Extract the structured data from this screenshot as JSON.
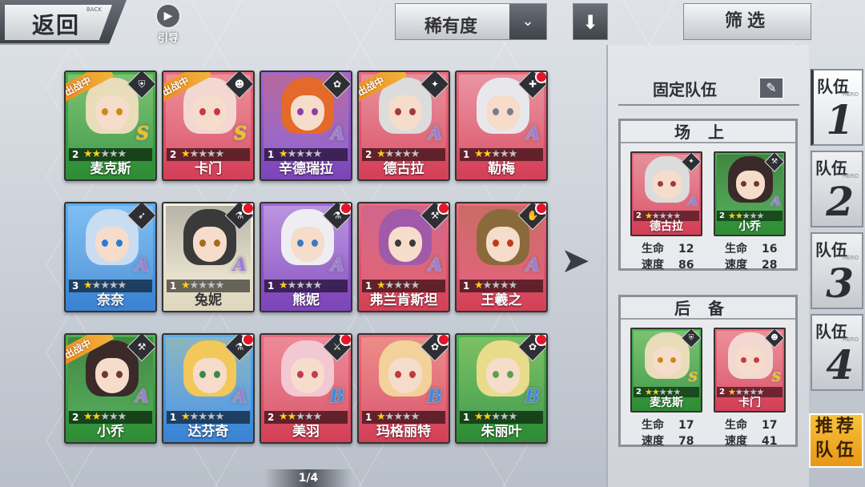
{
  "header": {
    "back_label": "返回",
    "back_sub": "BACK",
    "guide_label": "引导",
    "sort_label": "稀有度",
    "filter_label": "筛选"
  },
  "roster": [
    {
      "name": "麦克斯",
      "level": "2",
      "stars": 2,
      "grade": "S",
      "frame": "green",
      "in_battle": true,
      "badge": false,
      "class_icon": "shield-icon",
      "hair": "#e8ddb8",
      "eye": "#c98a1a"
    },
    {
      "name": "卡门",
      "level": "2",
      "stars": 1,
      "grade": "S",
      "frame": "red",
      "in_battle": true,
      "badge": false,
      "class_icon": "mask-icon",
      "hair": "#f3d8d2",
      "eye": "#c23a4a"
    },
    {
      "name": "辛德瑞拉",
      "level": "1",
      "stars": 1,
      "grade": "A",
      "frame": "purple",
      "in_battle": false,
      "badge": false,
      "class_icon": "rose-icon",
      "hair": "#e36a2a",
      "eye": "#8b3fa6"
    },
    {
      "name": "德古拉",
      "level": "2",
      "stars": 1,
      "grade": "A",
      "frame": "red",
      "in_battle": true,
      "badge": false,
      "class_icon": "shuriken-icon",
      "hair": "#dcdcdc",
      "eye": "#a23a3a"
    },
    {
      "name": "勒梅",
      "level": "1",
      "stars": 2,
      "grade": "A",
      "frame": "red",
      "in_battle": false,
      "badge": true,
      "class_icon": "cross-icon",
      "hair": "#e8e8ec",
      "eye": "#7a7a90"
    },
    {
      "name": "奈奈",
      "level": "3",
      "stars": 1,
      "grade": "A",
      "frame": "blue",
      "in_battle": false,
      "badge": false,
      "class_icon": "wing-icon",
      "hair": "#c8ddf2",
      "eye": "#2a7ad2"
    },
    {
      "name": "兔妮",
      "level": "1",
      "stars": 1,
      "grade": "A",
      "frame": "white",
      "in_battle": false,
      "badge": true,
      "class_icon": "flask-icon",
      "hair": "#3a3a3a",
      "eye": "#a86a1a"
    },
    {
      "name": "熊妮",
      "level": "1",
      "stars": 1,
      "grade": "A",
      "frame": "purple",
      "in_battle": false,
      "badge": true,
      "class_icon": "flask-icon",
      "hair": "#eeeef2",
      "eye": "#3a7ac2"
    },
    {
      "name": "弗兰肯斯坦",
      "level": "1",
      "stars": 1,
      "grade": "A",
      "frame": "red",
      "in_battle": false,
      "badge": true,
      "class_icon": "hammer-icon",
      "hair": "#a05aa8",
      "eye": "#3a3a3a"
    },
    {
      "name": "王羲之",
      "level": "1",
      "stars": 1,
      "grade": "A",
      "frame": "red",
      "in_battle": false,
      "badge": true,
      "class_icon": "hand-icon",
      "hair": "#8a6a3a",
      "eye": "#c23a1a"
    },
    {
      "name": "小乔",
      "level": "2",
      "stars": 2,
      "grade": "A",
      "frame": "green",
      "in_battle": true,
      "badge": false,
      "class_icon": "hammer-icon",
      "hair": "#3a2a2a",
      "eye": "#6a3a2a"
    },
    {
      "name": "达芬奇",
      "level": "1",
      "stars": 1,
      "grade": "A",
      "frame": "blue",
      "in_battle": false,
      "badge": true,
      "class_icon": "flask-icon",
      "hair": "#f2c85a",
      "eye": "#3a8a4a"
    },
    {
      "name": "美羽",
      "level": "2",
      "stars": 2,
      "grade": "B",
      "frame": "red",
      "in_battle": false,
      "badge": true,
      "class_icon": "sword-icon",
      "hair": "#f2c8d2",
      "eye": "#c23a5a"
    },
    {
      "name": "玛格丽特",
      "level": "1",
      "stars": 1,
      "grade": "B",
      "frame": "red",
      "in_battle": false,
      "badge": true,
      "class_icon": "rose-icon",
      "hair": "#f2d29a",
      "eye": "#c23a3a"
    },
    {
      "name": "朱丽叶",
      "level": "1",
      "stars": 2,
      "grade": "B",
      "frame": "green",
      "in_battle": false,
      "badge": true,
      "class_icon": "rose-icon",
      "hair": "#e8dc8a",
      "eye": "#5aa24a"
    }
  ],
  "in_battle_label": "出战中",
  "page_indicator": "1/4",
  "team_panel": {
    "title": "固定队伍",
    "on_field_label": "场上",
    "reserve_label": "后备",
    "hp_label": "生命",
    "speed_label": "速度",
    "on_field": [
      {
        "name": "德古拉",
        "level": "2",
        "stars": 1,
        "grade": "A",
        "frame": "red",
        "class_icon": "shuriken-icon",
        "hair": "#dcdcdc",
        "eye": "#a23a3a",
        "hp": "12",
        "speed": "86"
      },
      {
        "name": "小乔",
        "level": "2",
        "stars": 2,
        "grade": "A",
        "frame": "green",
        "class_icon": "hammer-icon",
        "hair": "#3a2a2a",
        "eye": "#6a3a2a",
        "hp": "16",
        "speed": "28"
      }
    ],
    "reserve": [
      {
        "name": "麦克斯",
        "level": "2",
        "stars": 2,
        "grade": "S",
        "frame": "green",
        "class_icon": "shield-icon",
        "hair": "#e8ddb8",
        "eye": "#c98a1a",
        "hp": "17",
        "speed": "78"
      },
      {
        "name": "卡门",
        "level": "2",
        "stars": 1,
        "grade": "S",
        "frame": "red",
        "class_icon": "mask-icon",
        "hair": "#f3d8d2",
        "eye": "#c23a4a",
        "hp": "17",
        "speed": "41"
      }
    ]
  },
  "team_tabs": [
    {
      "label": "队伍",
      "number": "1",
      "sub": "HERO",
      "active": true
    },
    {
      "label": "队伍",
      "number": "2",
      "sub": "HERO",
      "active": false
    },
    {
      "label": "队伍",
      "number": "3",
      "sub": "HERO",
      "active": false
    },
    {
      "label": "队伍",
      "number": "4",
      "sub": "HERO",
      "active": false
    }
  ],
  "recommend_label_1": "推荐",
  "recommend_label_2": "队伍",
  "colors": {
    "star_on": "#ffcc1c",
    "star_off": "#bfc2c6",
    "grade_S": "#f3c21c",
    "grade_A": "#9a7cd8",
    "grade_B": "#3a8ae2",
    "badge": "#e5152a",
    "battle_tag": "#f08a1d"
  }
}
